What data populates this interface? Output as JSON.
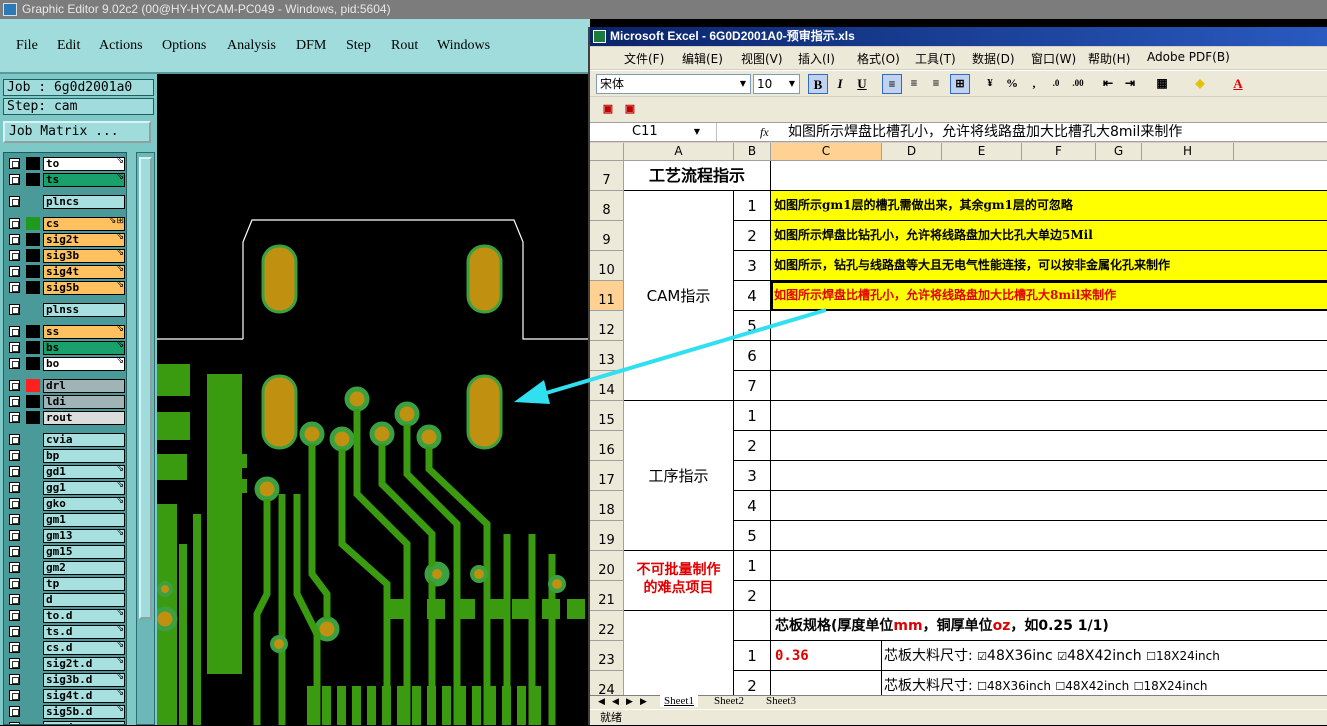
{
  "ge": {
    "title": "Graphic Editor 9.02c2 (00@HY-HYCAM-PC049 - Windows, pid:5604)",
    "menu": [
      "File",
      "Edit",
      "Actions",
      "Options",
      "Analysis",
      "DFM",
      "Step",
      "Rout",
      "Windows"
    ],
    "job": "Job : 6g0d2001a0",
    "step": "Step: cam",
    "job_matrix": "Job Matrix ...",
    "layers": [
      {
        "name": "to",
        "color": "#ffffff",
        "swatch": "#000000",
        "tag": "⇘"
      },
      {
        "name": "ts",
        "color": "#1aa06a",
        "swatch": "#000000",
        "tag": "⇘"
      },
      {
        "name": "plncs",
        "color": "#a8e0e0",
        "swatch": "",
        "tag": ""
      },
      {
        "name": "cs",
        "color": "#ffc060",
        "swatch": "#1f9a1f",
        "tag": "⇘⊞"
      },
      {
        "name": "sig2t",
        "color": "#ffc060",
        "swatch": "#000000",
        "tag": "⇘"
      },
      {
        "name": "sig3b",
        "color": "#ffc060",
        "swatch": "#000000",
        "tag": "⇘"
      },
      {
        "name": "sig4t",
        "color": "#ffc060",
        "swatch": "#000000",
        "tag": "⇘"
      },
      {
        "name": "sig5b",
        "color": "#ffc060",
        "swatch": "#000000",
        "tag": "⇘"
      },
      {
        "name": "plnss",
        "color": "#a8e0e0",
        "swatch": "",
        "tag": ""
      },
      {
        "name": "ss",
        "color": "#ffc060",
        "swatch": "#000000",
        "tag": "⇘"
      },
      {
        "name": "bs",
        "color": "#1aa06a",
        "swatch": "#000000",
        "tag": "⇘"
      },
      {
        "name": "bo",
        "color": "#ffffff",
        "swatch": "#000000",
        "tag": "⇘"
      },
      {
        "name": "drl",
        "color": "#a0b4b8",
        "swatch": "#ff2020",
        "tag": ""
      },
      {
        "name": "ldi",
        "color": "#a0b4b8",
        "swatch": "#000000",
        "tag": ""
      },
      {
        "name": "rout",
        "color": "#dcdcdc",
        "swatch": "#000000",
        "tag": ""
      },
      {
        "name": "cvia",
        "color": "#a8e0e0",
        "swatch": "",
        "tag": ""
      },
      {
        "name": "bp",
        "color": "#a8e0e0",
        "swatch": "",
        "tag": ""
      },
      {
        "name": "gd1",
        "color": "#a8e0e0",
        "swatch": "",
        "tag": "⇘"
      },
      {
        "name": "gg1",
        "color": "#a8e0e0",
        "swatch": "",
        "tag": "⇘"
      },
      {
        "name": "gko",
        "color": "#a8e0e0",
        "swatch": "",
        "tag": "⇘"
      },
      {
        "name": "gm1",
        "color": "#a8e0e0",
        "swatch": "",
        "tag": ""
      },
      {
        "name": "gm13",
        "color": "#a8e0e0",
        "swatch": "",
        "tag": "⇘"
      },
      {
        "name": "gm15",
        "color": "#a8e0e0",
        "swatch": "",
        "tag": ""
      },
      {
        "name": "gm2",
        "color": "#a8e0e0",
        "swatch": "",
        "tag": ""
      },
      {
        "name": "tp",
        "color": "#a8e0e0",
        "swatch": "",
        "tag": ""
      },
      {
        "name": "d",
        "color": "#a8e0e0",
        "swatch": "",
        "tag": ""
      },
      {
        "name": "to.d",
        "color": "#a8e0e0",
        "swatch": "",
        "tag": "⇘"
      },
      {
        "name": "ts.d",
        "color": "#a8e0e0",
        "swatch": "",
        "tag": "⇘"
      },
      {
        "name": "cs.d",
        "color": "#a8e0e0",
        "swatch": "",
        "tag": "⇘"
      },
      {
        "name": "sig2t.d",
        "color": "#a8e0e0",
        "swatch": "",
        "tag": "⇘"
      },
      {
        "name": "sig3b.d",
        "color": "#a8e0e0",
        "swatch": "",
        "tag": "⇘"
      },
      {
        "name": "sig4t.d",
        "color": "#a8e0e0",
        "swatch": "",
        "tag": "⇘"
      },
      {
        "name": "sig5b.d",
        "color": "#a8e0e0",
        "swatch": "",
        "tag": "⇘"
      },
      {
        "name": "ss.d",
        "color": "#a8e0e0",
        "swatch": "",
        "tag": ""
      }
    ]
  },
  "xl": {
    "title": "Microsoft Excel - 6G0D2001A0-预审指示.xls",
    "menu": [
      "文件(F)",
      "编辑(E)",
      "视图(V)",
      "插入(I)",
      "格式(O)",
      "工具(T)",
      "数据(D)",
      "窗口(W)",
      "帮助(H)",
      "Adobe PDF(B)"
    ],
    "font_name": "宋体",
    "font_size": "10",
    "name_box": "C11",
    "fx": "fx",
    "formula": "如图所示焊盘比槽孔小，允许将线路盘加大比槽孔大8mil来制作",
    "columns": [
      "A",
      "B",
      "C",
      "D",
      "E",
      "F",
      "G",
      "H"
    ],
    "rows": [
      "7",
      "8",
      "9",
      "10",
      "11",
      "12",
      "13",
      "14",
      "15",
      "16",
      "17",
      "18",
      "19",
      "20",
      "21",
      "22",
      "23",
      "24"
    ],
    "r7_a": "工艺流程指示",
    "cam_label": "CAM指示",
    "cam_nums": [
      "1",
      "2",
      "3",
      "4",
      "5",
      "6",
      "7"
    ],
    "cam_texts": [
      "如图所示gm1层的槽孔需做出来，其余gm1层的可忽略",
      "如图所示焊盘比钻孔小，允许将线路盘加大比孔大单边5Mil",
      "如图所示，钻孔与线路盘等大且无电气性能连接，可以按非金属化孔来制作",
      "如图所示焊盘比槽孔小，允许将线路盘加大比槽孔大8mil来制作"
    ],
    "proc_label": "工序指示",
    "proc_nums": [
      "1",
      "2",
      "3",
      "4",
      "5"
    ],
    "hard_label_1": "不可批量制作",
    "hard_label_2": "的难点项目",
    "hard_nums": [
      "1",
      "2"
    ],
    "r22_text_a": "芯板规格(厚度单位",
    "r22_text_b": "mm",
    "r22_text_c": "，铜厚单位",
    "r22_text_d": "oz",
    "r22_text_e": "，如0.25 1/1)",
    "r23_b": "1",
    "r23_c": "0.36",
    "r23_label": "芯板大料尺寸:",
    "r23_opt1": "48X36inc",
    "r23_opt2": "48X42inch",
    "r23_opt3": "18X24inch",
    "r24_b": "2",
    "r24_label": "芯板大料尺寸:",
    "r24_opt1": "48X36inch",
    "r24_opt2": "48X42inch",
    "r24_opt3": "18X24inch",
    "sheets": [
      "Sheet1",
      "Sheet2",
      "Sheet3"
    ],
    "status": "就绪"
  }
}
